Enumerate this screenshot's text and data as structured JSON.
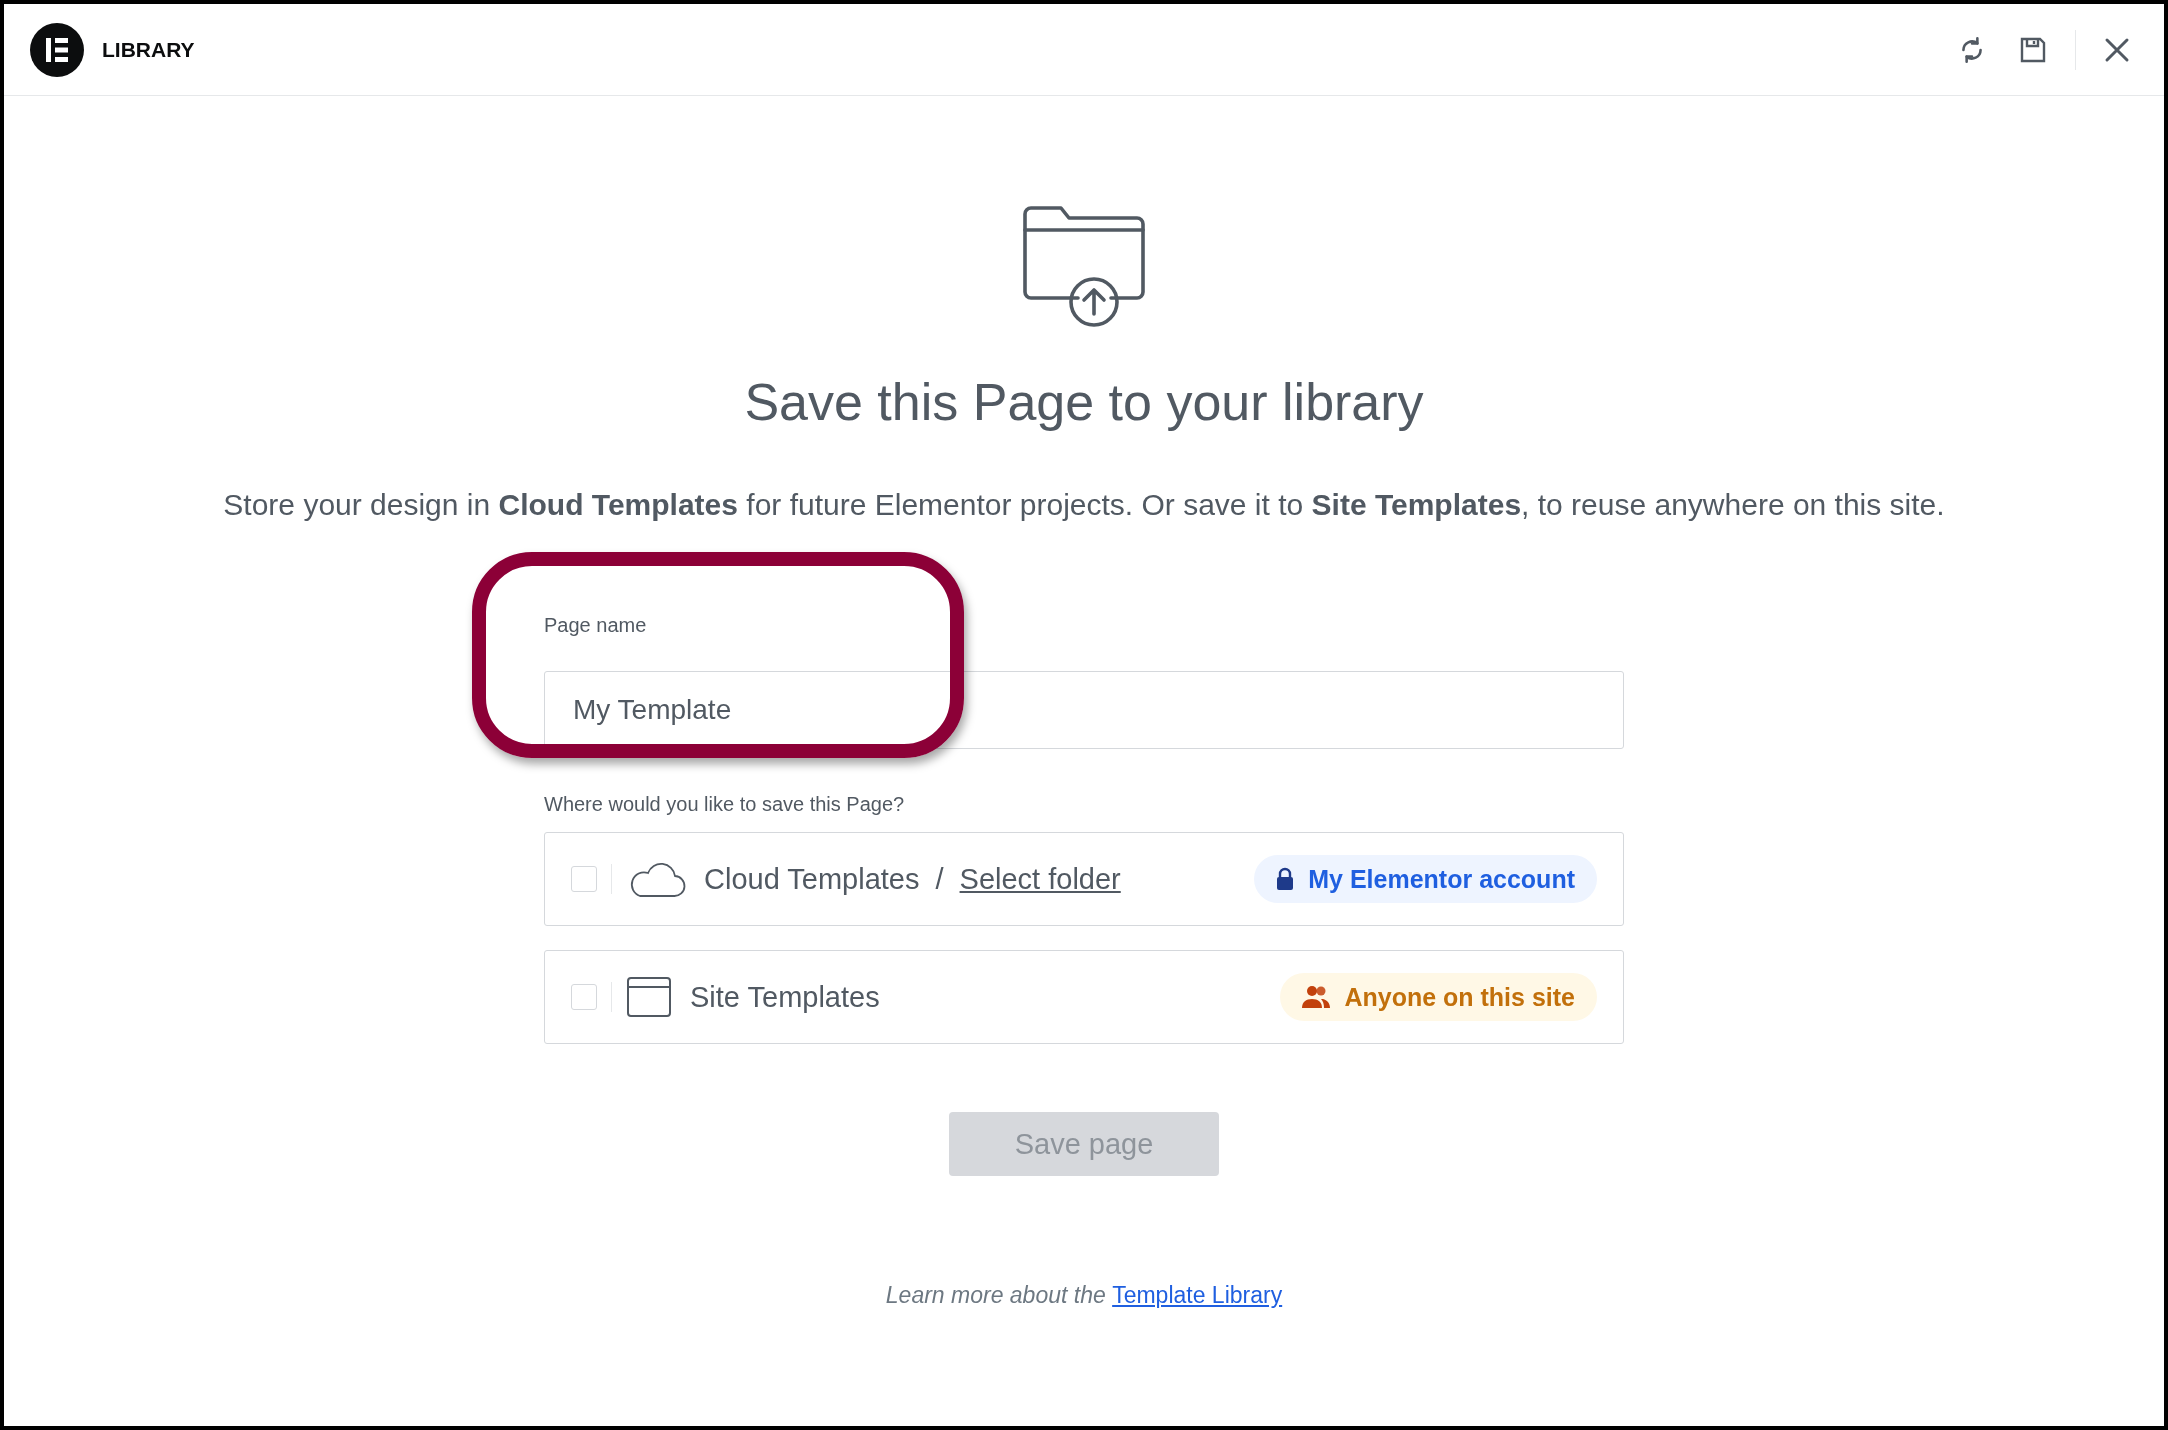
{
  "header": {
    "title": "LIBRARY",
    "actions": [
      {
        "kind": "sync"
      },
      {
        "kind": "save"
      },
      {
        "kind": "close"
      }
    ]
  },
  "heading": "Save this Page to your library",
  "description": "Store your design in **Cloud Templates** for future Elementor projects. Or save it to **Site Templates**, to reuse anywhere on this site.",
  "name_field": {
    "label": "Page name",
    "value": "My Template",
    "highlighted": true
  },
  "location_label": "Where would you like to save this Page?",
  "locations": [
    {
      "kind": "cloud",
      "label": "Cloud Templates",
      "separator": "/",
      "link": "Select folder",
      "checked": false,
      "badge": {
        "kind": "account",
        "text": "My Elementor account"
      }
    },
    {
      "kind": "site",
      "label": "Site Templates",
      "checked": false,
      "badge": {
        "kind": "people",
        "text": "Anyone on this site"
      }
    }
  ],
  "save_button": {
    "label": "Save page",
    "disabled": true
  },
  "footer": {
    "text": "Learn more about the",
    "link": "Template Library"
  }
}
